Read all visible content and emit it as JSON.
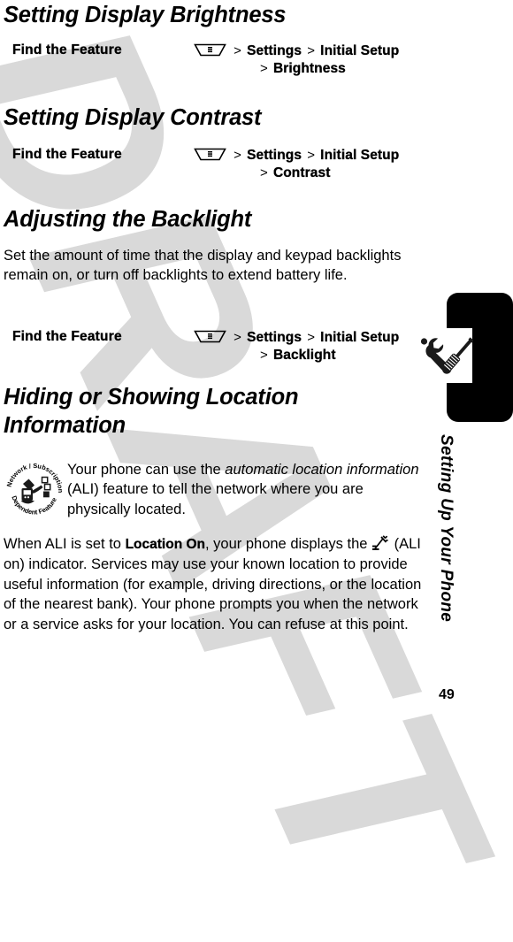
{
  "page": {
    "number": "49",
    "side_tab_title": "Setting Up Your Phone",
    "watermark": "DRAFT"
  },
  "sections": [
    {
      "heading": "Setting Display Brightness",
      "find_the_feature": {
        "label": "Find the Feature",
        "menu_icon": "menu-key-icon",
        "separator": ">",
        "path_line1": [
          "Settings",
          "Initial Setup"
        ],
        "path_line2": [
          "Brightness"
        ]
      }
    },
    {
      "heading": "Setting Display Contrast",
      "find_the_feature": {
        "label": "Find the Feature",
        "menu_icon": "menu-key-icon",
        "separator": ">",
        "path_line1": [
          "Settings",
          "Initial Setup"
        ],
        "path_line2": [
          "Contrast"
        ]
      }
    },
    {
      "heading": "Adjusting the Backlight",
      "body": "Set the amount of time that the display and keypad backlights remain on, or turn off backlights to extend battery life.",
      "find_the_feature": {
        "label": "Find the Feature",
        "menu_icon": "menu-key-icon",
        "separator": ">",
        "path_line1": [
          "Settings",
          "Initial Setup"
        ],
        "path_line2": [
          "Backlight"
        ]
      }
    },
    {
      "heading_line1": "Hiding or Showing Location",
      "heading_line2": "Information",
      "badge": {
        "icon": "network-subscription-dependent-feature-icon",
        "top_text": "Network / Subscription",
        "bottom_text": "Dependent Feature"
      },
      "note_paragraph": {
        "t1": "Your phone can use the ",
        "em1": "automatic location information",
        "t2": " (ALI) feature to tell the network where you are physically located."
      },
      "body_paragraph": {
        "t1": "When ALI is set to ",
        "b1": "Location On",
        "t2": ", your phone displays the ",
        "icon": "ali-on-indicator-icon",
        "t3": " (ALI on) indicator. Services may use your known location to provide useful information (for example, driving directions, or the location of the nearest bank). Your phone prompts you when the network or a service asks for your location. You can refuse at this point."
      }
    }
  ],
  "colors": {
    "text": "#000000",
    "watermark": "#d9d9d9",
    "tab": "#000000",
    "background": "#ffffff"
  }
}
